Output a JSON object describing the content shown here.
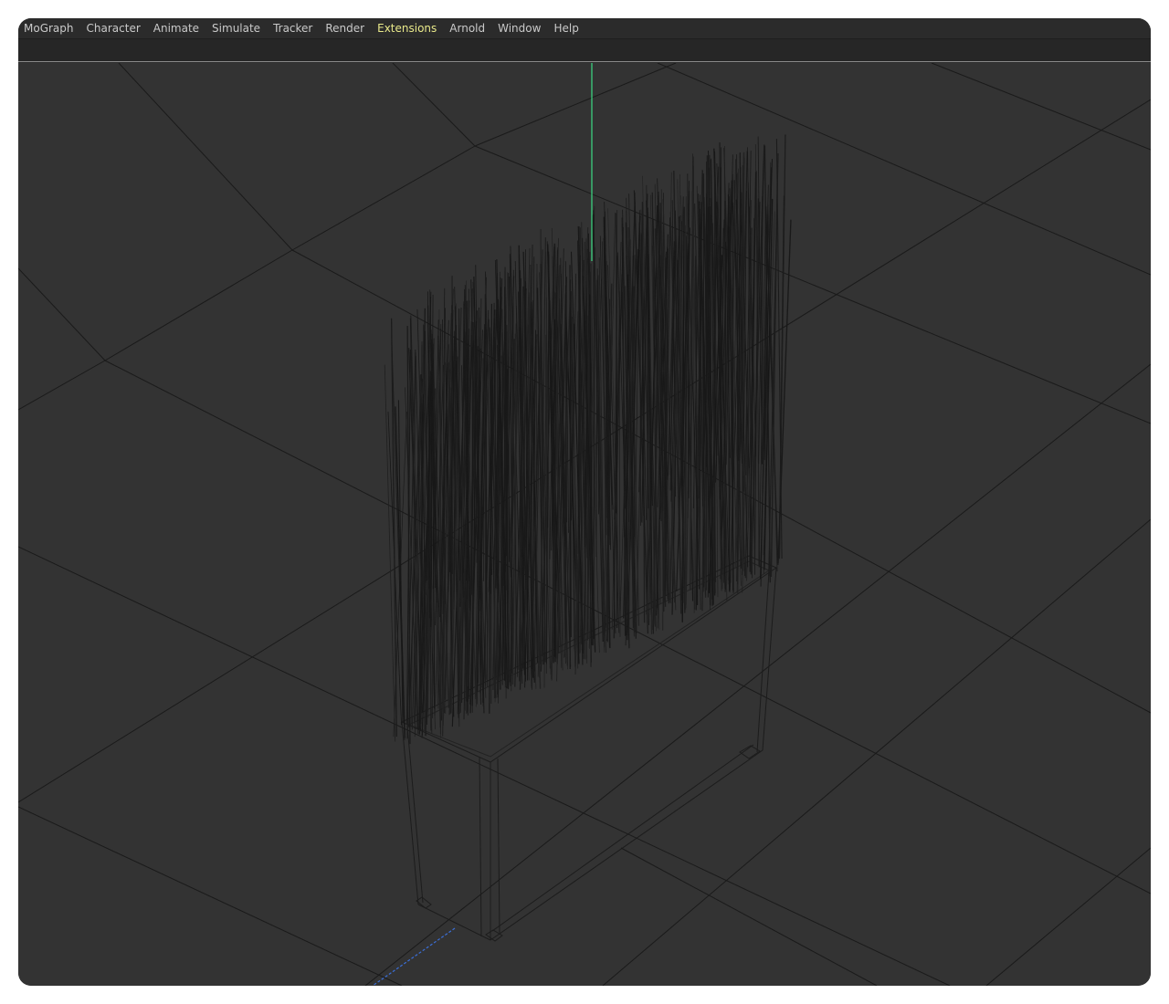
{
  "menubar": {
    "items": [
      {
        "label": "MoGraph",
        "active": false
      },
      {
        "label": "Character",
        "active": false
      },
      {
        "label": "Animate",
        "active": false
      },
      {
        "label": "Simulate",
        "active": false
      },
      {
        "label": "Tracker",
        "active": false
      },
      {
        "label": "Render",
        "active": false
      },
      {
        "label": "Extensions",
        "active": true
      },
      {
        "label": "Arnold",
        "active": false
      },
      {
        "label": "Window",
        "active": false
      },
      {
        "label": "Help",
        "active": false
      }
    ]
  },
  "viewport": {
    "display_mode": "wireframe",
    "object": "grass-planter",
    "colors": {
      "background": "#333333",
      "grid": "#1a1a1a",
      "wire": "#1c1c1c",
      "y_axis": "#3ddc84",
      "z_axis": "#3b6fd8"
    }
  }
}
